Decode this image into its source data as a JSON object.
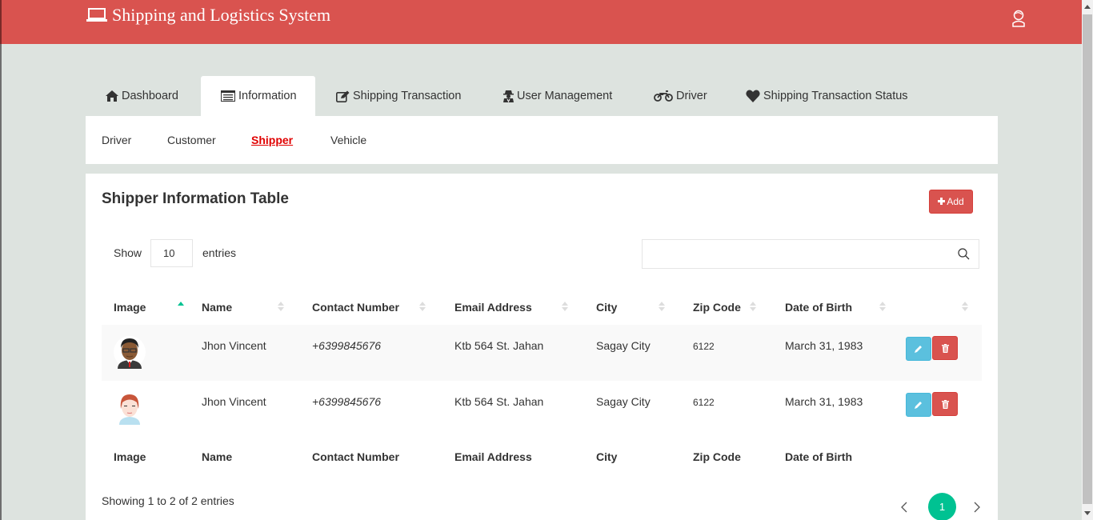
{
  "app": {
    "title": "Shipping and Logistics System",
    "brand_icon": "laptop-icon",
    "user_icon": "user-avatar-icon",
    "accent_color": "#d9534f"
  },
  "tabs": [
    {
      "label": "Dashboard",
      "icon": "home-icon",
      "active": false
    },
    {
      "label": "Information",
      "icon": "list-alt-icon",
      "active": true
    },
    {
      "label": "Shipping Transaction",
      "icon": "edit-icon",
      "active": false
    },
    {
      "label": "User Management",
      "icon": "user-secret-icon",
      "active": false
    },
    {
      "label": "Driver",
      "icon": "motorcycle-icon",
      "active": false
    },
    {
      "label": "Shipping Transaction Status",
      "icon": "heart-icon",
      "active": false
    }
  ],
  "subnav": [
    {
      "label": "Driver",
      "active": false
    },
    {
      "label": "Customer",
      "active": false
    },
    {
      "label": "Shipper",
      "active": true
    },
    {
      "label": "Vehicle",
      "active": false
    }
  ],
  "panel": {
    "title": "Shipper Information Table",
    "add_label": "Add",
    "show_label": "Show",
    "entries_value": "10",
    "entries_label": "entries",
    "search_value": "",
    "search_placeholder": ""
  },
  "table": {
    "columns": [
      "Image",
      "Name",
      "Contact Number",
      "Email Address",
      "City",
      "Zip Code",
      "Date of Birth",
      ""
    ],
    "sorted_column": "Image",
    "sort_direction": "ascending",
    "rows": [
      {
        "avatar": "male-avatar-glasses",
        "name": "Jhon Vincent",
        "contact": "+6399845676",
        "email": "Ktb 564 St. Jahan",
        "city": "Sagay City",
        "zip": "6122",
        "dob": "March 31, 1983"
      },
      {
        "avatar": "male-avatar-redhair",
        "name": "Jhon Vincent",
        "contact": "+6399845676",
        "email": "Ktb 564 St. Jahan",
        "city": "Sagay City",
        "zip": "6122",
        "dob": "March 31, 1983"
      }
    ],
    "footer_columns": [
      "Image",
      "Name",
      "Contact Number",
      "Email Address",
      "City",
      "Zip Code",
      "Date of Birth"
    ]
  },
  "pagination": {
    "info": "Showing 1 to 2 of 2 entries",
    "current_page": "1",
    "pages": [
      "1"
    ],
    "active_color": "#00c292"
  }
}
